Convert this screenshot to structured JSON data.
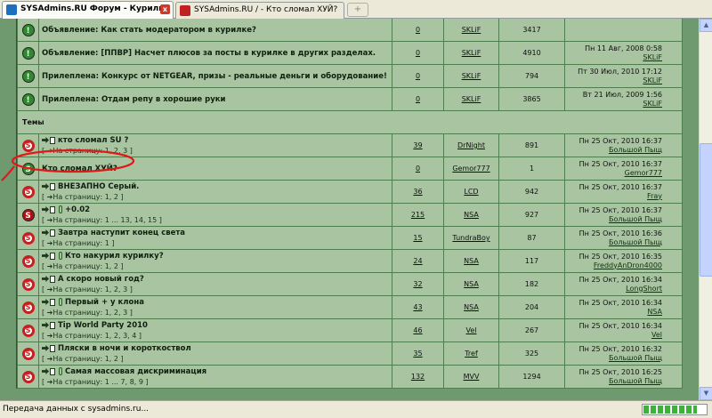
{
  "tabs": [
    {
      "label": "SYSAdmins.RU Форум - Курилка",
      "active": true,
      "favicon_color": "#1f6fbf"
    },
    {
      "label": "SYSAdmins.RU / - Кто сломал ХУЙ?",
      "active": false,
      "favicon_color": "#c02020"
    }
  ],
  "new_tab_label": "+",
  "close_label": "x",
  "section_title": "Темы",
  "announcements": [
    {
      "icon": "green",
      "title": "Объявление: Как стать модератором в курилке?",
      "replies": "0",
      "author": "SKLiF",
      "views": "3417",
      "last_date": "",
      "last_user": ""
    },
    {
      "icon": "green",
      "title": "Объявление: [ППВР] Насчет плюсов за посты в курилке в других разделах.",
      "replies": "0",
      "author": "SKLiF",
      "views": "4910",
      "last_date": "Пн 11 Авг, 2008 0:58",
      "last_user": "SKLiF"
    },
    {
      "icon": "green",
      "title": "Прилеплена: Конкурс от NETGEAR, призы - реальные деньги и оборудование!",
      "replies": "0",
      "author": "SKLiF",
      "views": "794",
      "last_date": "Пт 30 Июл, 2010 17:12",
      "last_user": "SKLiF"
    },
    {
      "icon": "green",
      "title": "Прилеплена: Отдам репу в хорошие руки",
      "replies": "0",
      "author": "SKLiF",
      "views": "3865",
      "last_date": "Вт 21 Июл, 2009 1:56",
      "last_user": "SKLiF"
    }
  ],
  "topics": [
    {
      "icon": "S",
      "style": "red",
      "pin": false,
      "title": "кто сломал SU ?",
      "pages": "[ ➔На страницу: 1, 2, 3 ]",
      "replies": "39",
      "author": "DrNight",
      "views": "891",
      "last_date": "Пн 25 Окт, 2010 16:37",
      "last_user": "Большой Пыщ"
    },
    {
      "icon": "S",
      "style": "green",
      "pin": false,
      "title": "Кто сломал ХУЙ?",
      "pages": "",
      "replies": "0",
      "author": "Gemor777",
      "views": "1",
      "last_date": "Пн 25 Окт, 2010 16:37",
      "last_user": "Gemor777"
    },
    {
      "icon": "S",
      "style": "red",
      "pin": false,
      "title": "ВНЕЗАПНО Серый.",
      "pages": "[ ➔На страницу: 1, 2 ]",
      "replies": "36",
      "author": "LCD",
      "views": "942",
      "last_date": "Пн 25 Окт, 2010 16:37",
      "last_user": "Fray"
    },
    {
      "icon": "S",
      "style": "redfill",
      "pin": true,
      "title": "+0.02",
      "pages": "[ ➔На страницу: 1 ... 13, 14, 15 ]",
      "replies": "215",
      "author": "NSA",
      "views": "927",
      "last_date": "Пн 25 Окт, 2010 16:37",
      "last_user": "Большой Пыщ"
    },
    {
      "icon": "S",
      "style": "red",
      "pin": false,
      "title": "Завтра наступит конец света",
      "pages": "[ ➔На страницу: 1 ]",
      "replies": "15",
      "author": "TundraBoy",
      "views": "87",
      "last_date": "Пн 25 Окт, 2010 16:36",
      "last_user": "Большой Пыщ"
    },
    {
      "icon": "S",
      "style": "red",
      "pin": true,
      "title": "Кто накурил курилку?",
      "pages": "[ ➔На страницу: 1, 2 ]",
      "replies": "24",
      "author": "NSA",
      "views": "117",
      "last_date": "Пн 25 Окт, 2010 16:35",
      "last_user": "FreddyAnDron4000"
    },
    {
      "icon": "S",
      "style": "red",
      "pin": false,
      "title": "А скоро новый год?",
      "pages": "[ ➔На страницу: 1, 2, 3 ]",
      "replies": "32",
      "author": "NSA",
      "views": "182",
      "last_date": "Пн 25 Окт, 2010 16:34",
      "last_user": "LongShort"
    },
    {
      "icon": "S",
      "style": "red",
      "pin": true,
      "title": "Первый + у клона",
      "pages": "[ ➔На страницу: 1, 2, 3 ]",
      "replies": "43",
      "author": "NSA",
      "views": "204",
      "last_date": "Пн 25 Окт, 2010 16:34",
      "last_user": "NSA"
    },
    {
      "icon": "S",
      "style": "red",
      "pin": false,
      "title": "Tip World Party 2010",
      "pages": "[ ➔На страницу: 1, 2, 3, 4 ]",
      "replies": "46",
      "author": "Vel",
      "views": "267",
      "last_date": "Пн 25 Окт, 2010 16:34",
      "last_user": "Vel"
    },
    {
      "icon": "S",
      "style": "red",
      "pin": false,
      "title": "Пляски в ночи и короткоствол",
      "pages": "[ ➔На страницу: 1, 2 ]",
      "replies": "35",
      "author": "Tref",
      "views": "325",
      "last_date": "Пн 25 Окт, 2010 16:32",
      "last_user": "Большой Пыщ"
    },
    {
      "icon": "S",
      "style": "red",
      "pin": true,
      "title": "Самая массовая дискриминация",
      "pages": "[ ➔На страницу: 1 ... 7, 8, 9 ]",
      "replies": "132",
      "author": "MVV",
      "views": "1294",
      "last_date": "Пн 25 Окт, 2010 16:25",
      "last_user": "Большой Пыщ"
    }
  ],
  "status_text": "Передача данных с sysadmins.ru...",
  "progress_fraction": 0.85
}
